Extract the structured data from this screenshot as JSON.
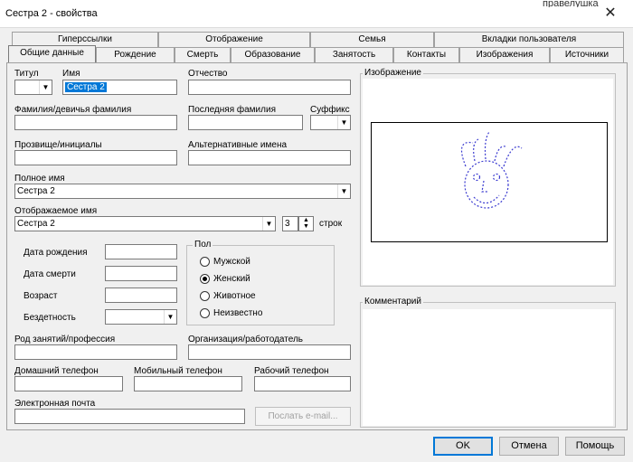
{
  "window": {
    "title": "Сестра 2 - свойства",
    "close_glyph": "✕",
    "background_text": "правелушка"
  },
  "tabs_back": [
    {
      "label": "Гиперссылки"
    },
    {
      "label": "Отображение"
    },
    {
      "label": "Семья"
    },
    {
      "label": "Вкладки пользователя"
    }
  ],
  "tabs_front": [
    {
      "label": "Общие данные"
    },
    {
      "label": "Рождение"
    },
    {
      "label": "Смерть"
    },
    {
      "label": "Образование"
    },
    {
      "label": "Занятость"
    },
    {
      "label": "Контакты"
    },
    {
      "label": "Изображения"
    },
    {
      "label": "Источники"
    }
  ],
  "form": {
    "title_label": "Титул",
    "title_value": "",
    "name_label": "Имя",
    "name_value": "Сестра 2",
    "patronymic_label": "Отчество",
    "patronymic_value": "",
    "surname_label": "Фамилия/девичья фамилия",
    "surname_value": "",
    "last_surname_label": "Последняя фамилия",
    "last_surname_value": "",
    "suffix_label": "Суффикс",
    "suffix_value": "",
    "nickname_label": "Прозвище/инициалы",
    "nickname_value": "",
    "alt_names_label": "Альтернативные имена",
    "alt_names_value": "",
    "full_name_label": "Полное имя",
    "full_name_value": "Сестра 2",
    "display_name_label": "Отображаемое имя",
    "display_name_value": "Сестра 2",
    "lines_value": "3",
    "lines_label": "строк",
    "birth_date_label": "Дата рождения",
    "birth_date_value": "",
    "death_date_label": "Дата смерти",
    "death_date_value": "",
    "age_label": "Возраст",
    "age_value": "",
    "childless_label": "Бездетность",
    "childless_value": "",
    "occupation_label": "Род занятий/профессия",
    "occupation_value": "",
    "employer_label": "Организация/работодатель",
    "employer_value": "",
    "home_phone_label": "Домашний телефон",
    "home_phone_value": "",
    "mobile_phone_label": "Мобильный телефон",
    "mobile_phone_value": "",
    "work_phone_label": "Рабочий телефон",
    "work_phone_value": "",
    "email_label": "Электронная почта",
    "email_value": "",
    "send_email_label": "Послать e-mail..."
  },
  "gender": {
    "legend": "Пол",
    "options": [
      {
        "label": "Мужской",
        "checked": false
      },
      {
        "label": "Женский",
        "checked": true
      },
      {
        "label": "Животное",
        "checked": false
      },
      {
        "label": "Неизвестно",
        "checked": false
      }
    ]
  },
  "image_panel": {
    "legend": "Изображение",
    "drawing_color": "#3a3ad0"
  },
  "comment_panel": {
    "legend": "Комментарий",
    "value": ""
  },
  "buttons": {
    "ok": "OK",
    "cancel": "Отмена",
    "help": "Помощь"
  },
  "icons": {
    "dropdown": "chevron-down-icon",
    "spin": "spin-updown-icon",
    "close": "close-icon"
  }
}
